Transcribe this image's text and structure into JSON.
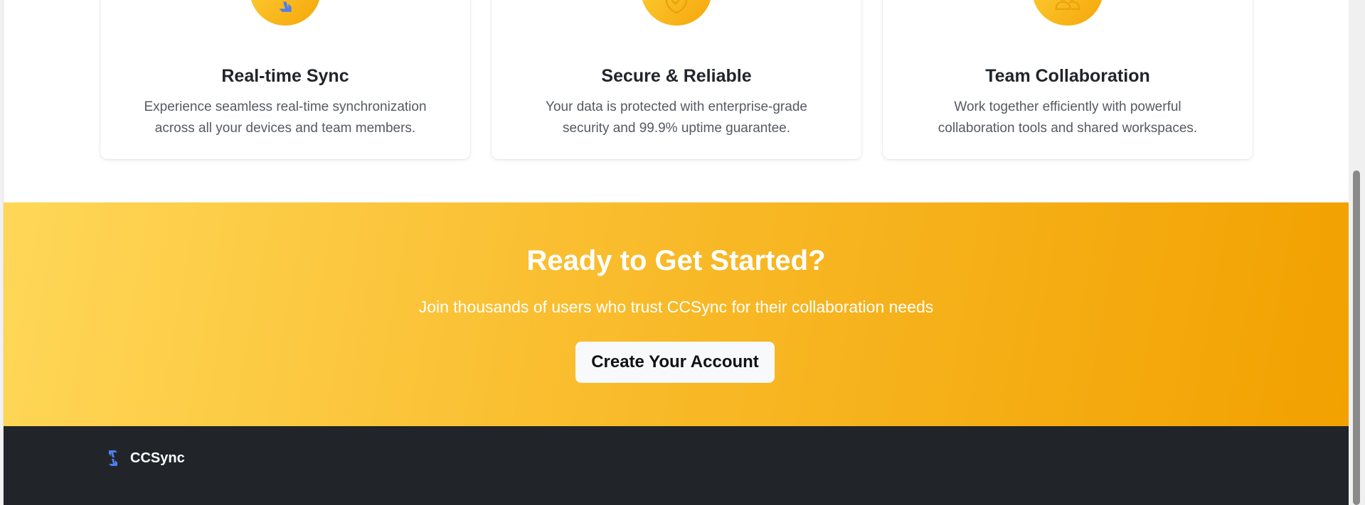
{
  "features": [
    {
      "icon": "sync-icon",
      "title": "Real-time Sync",
      "description": "Experience seamless real-time synchronization across all your devices and team members."
    },
    {
      "icon": "shield-check-icon",
      "title": "Secure & Reliable",
      "description": "Your data is protected with enterprise-grade security and 99.9% uptime guarantee."
    },
    {
      "icon": "people-icon",
      "title": "Team Collaboration",
      "description": "Work together efficiently with powerful collaboration tools and shared workspaces."
    }
  ],
  "cta": {
    "title": "Ready to Get Started?",
    "subtitle": "Join thousands of users who trust CCSync for their collaboration needs",
    "button_label": "Create Your Account"
  },
  "footer": {
    "brand_name": "CCSync",
    "logo_icon": "sync-icon"
  },
  "colors": {
    "accent_start": "#ffd758",
    "accent_end": "#f2a100",
    "sync_blue": "#4f7df0",
    "footer_bg": "#212529"
  }
}
